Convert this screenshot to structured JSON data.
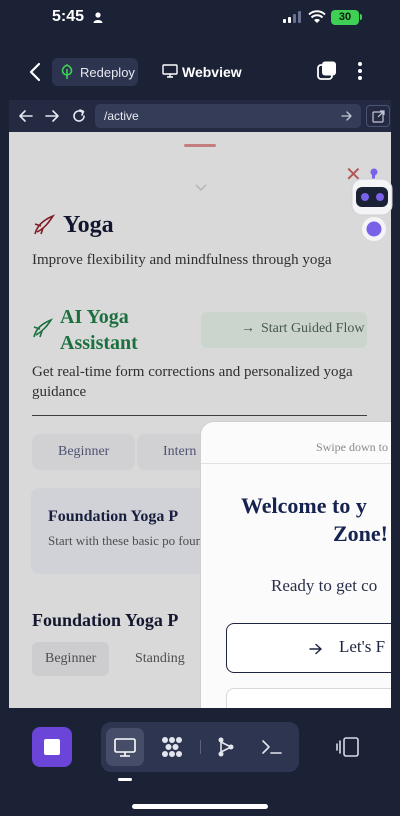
{
  "status_bar": {
    "time": "5:45",
    "battery": "30"
  },
  "header": {
    "redeploy_label": "Redeploy",
    "webview_label": "Webview",
    "icons": [
      "back-icon",
      "leaf-icon",
      "monitor-icon",
      "copy-icon",
      "more-icon"
    ]
  },
  "toolbar": {
    "url": "/active",
    "icons": [
      "back-arrow-icon",
      "forward-arrow-icon",
      "reload-icon",
      "go-arrow-icon",
      "external-link-icon"
    ]
  },
  "page": {
    "title": "Yoga",
    "subtitle": "Improve flexibility and mindfulness through yoga",
    "ai_title": "AI Yoga Assistant",
    "guided_button": "Start Guided Flow",
    "ai_description": "Get real-time form corrections and personalized yoga guidance",
    "level_tabs": [
      "Beginner",
      "Intern"
    ],
    "card": {
      "title": "Foundation Yoga P",
      "description": "Start with these basic po foundation for your yog"
    },
    "section_title": "Foundation Yoga P",
    "chips": [
      "Beginner",
      "Standing"
    ]
  },
  "sheet": {
    "swipe_hint": "Swipe down to",
    "welcome_line1": "Welcome to y",
    "welcome_line2": "Zone!",
    "ready_text": "Ready to get co",
    "lets_button": "Let's F"
  },
  "bottom_bar": {
    "icons": [
      "stop-icon",
      "monitor-icon",
      "grid-icon",
      "graph-icon",
      "terminal-icon",
      "split-view-icon"
    ]
  },
  "colors": {
    "background": "#1c2236",
    "accent_purple": "#6a45d8",
    "ai_green": "#1f7a45",
    "battery_green": "#3ecf55"
  }
}
